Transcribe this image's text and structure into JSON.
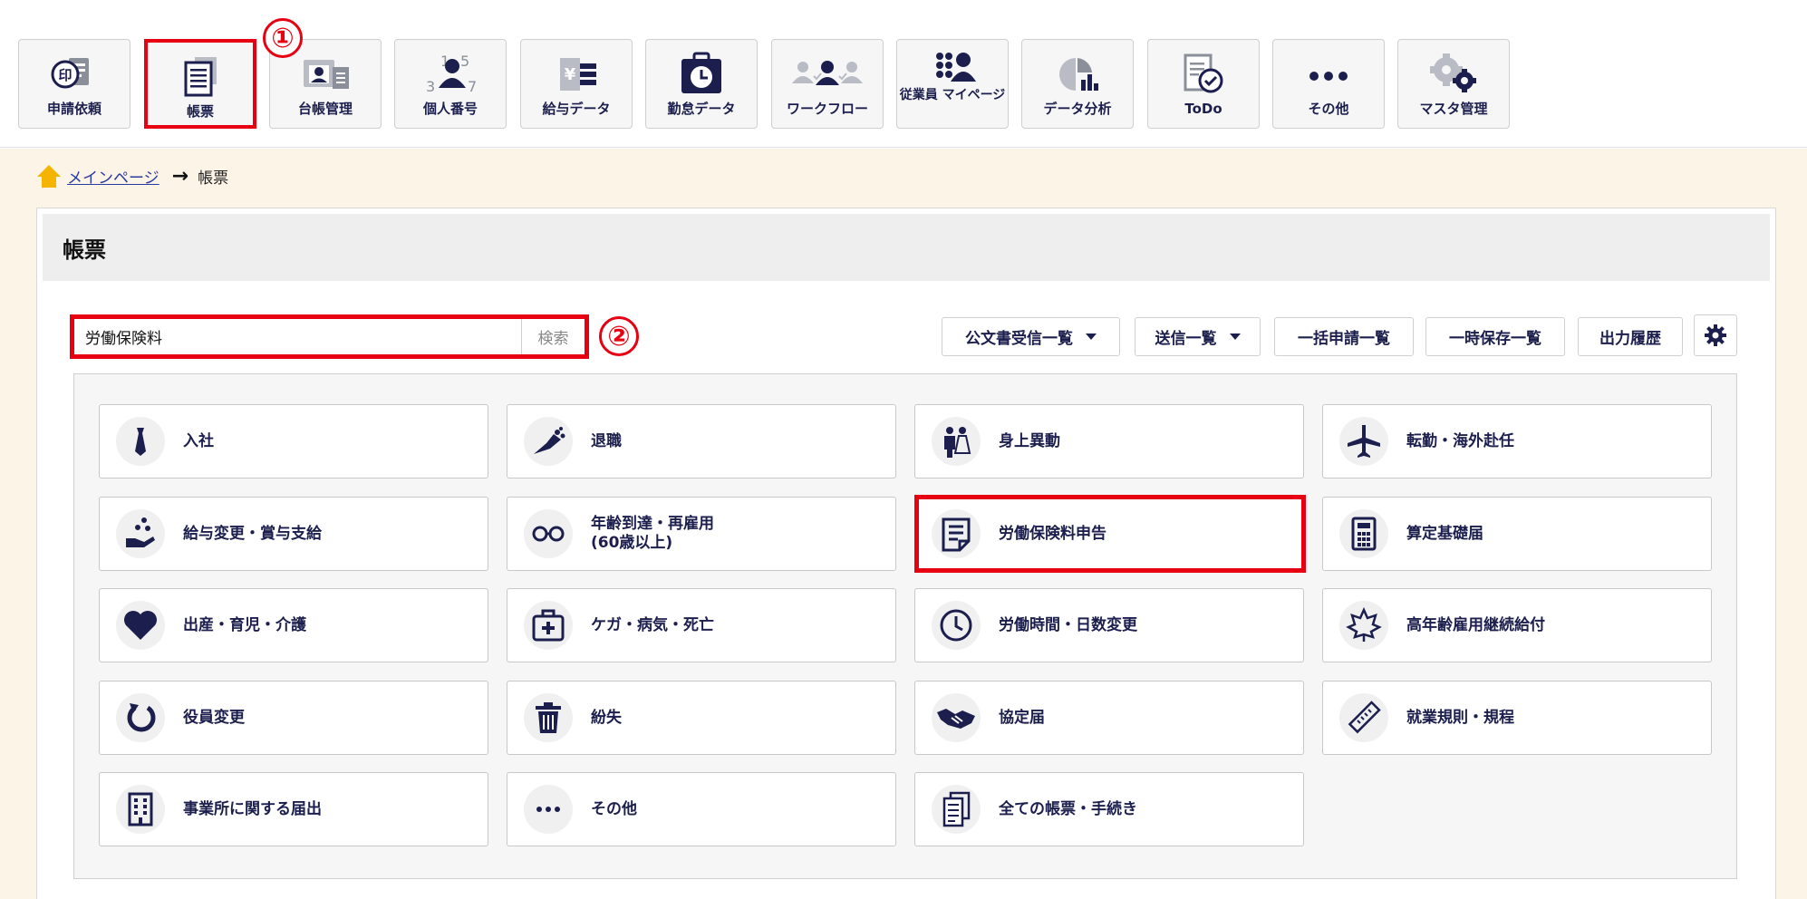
{
  "topnav": {
    "items": [
      {
        "label": "申請依頼",
        "icon": "stamp-request-icon"
      },
      {
        "label": "帳票",
        "icon": "document-forms-icon",
        "selected": true
      },
      {
        "label": "台帳管理",
        "icon": "ledger-card-icon"
      },
      {
        "label": "個人番号",
        "icon": "personal-number-icon"
      },
      {
        "label": "給与データ",
        "icon": "payroll-data-icon"
      },
      {
        "label": "勤怠データ",
        "icon": "attendance-clock-icon"
      },
      {
        "label": "ワークフロー",
        "icon": "workflow-people-icon"
      },
      {
        "label": "従業員\nマイページ",
        "icon": "employee-mypage-icon"
      },
      {
        "label": "データ分析",
        "icon": "data-analysis-icon"
      },
      {
        "label": "ToDo",
        "icon": "todo-check-icon"
      },
      {
        "label": "その他",
        "icon": "more-dots-icon"
      },
      {
        "label": "マスタ管理",
        "icon": "master-gears-icon"
      }
    ]
  },
  "callouts": {
    "one": "①",
    "two": "②"
  },
  "breadcrumb": {
    "home": "メインページ",
    "arrow": "→",
    "current": "帳票"
  },
  "panel": {
    "title": "帳票"
  },
  "search": {
    "value": "労働保険料",
    "button": "検索"
  },
  "toolbar": {
    "official_received": "公文書受信一覧",
    "sent_list": "送信一覧",
    "bulk_applications": "一括申請一覧",
    "temp_saved": "一時保存一覧",
    "output_history": "出力履歴",
    "settings_icon": "gear-icon"
  },
  "tiles": [
    {
      "label": "入社",
      "icon": "tie-icon"
    },
    {
      "label": "退職",
      "icon": "bouquet-icon"
    },
    {
      "label": "身上異動",
      "icon": "wedding-couple-icon"
    },
    {
      "label": "転勤・海外赴任",
      "icon": "airplane-icon"
    },
    {
      "label": "給与変更・賞与支給",
      "icon": "hand-coins-icon"
    },
    {
      "label": "年齢到達・再雇用\n(60歳以上)",
      "icon": "glasses-icon"
    },
    {
      "label": "労働保険料申告",
      "icon": "document-lines-icon",
      "highlighted": true
    },
    {
      "label": "算定基礎届",
      "icon": "calculator-icon"
    },
    {
      "label": "出産・育児・介護",
      "icon": "heart-icon"
    },
    {
      "label": "ケガ・病気・死亡",
      "icon": "first-aid-kit-icon"
    },
    {
      "label": "労働時間・日数変更",
      "icon": "clock-icon"
    },
    {
      "label": "高年齢雇用継続給付",
      "icon": "maple-leaf-icon"
    },
    {
      "label": "役員変更",
      "icon": "refresh-arrow-icon"
    },
    {
      "label": "紛失",
      "icon": "trash-can-icon"
    },
    {
      "label": "協定届",
      "icon": "handshake-icon"
    },
    {
      "label": "就業規則・規程",
      "icon": "ruler-icon"
    },
    {
      "label": "事業所に関する届出",
      "icon": "office-building-icon"
    },
    {
      "label": "その他",
      "icon": "more-dots-icon"
    },
    {
      "label": "全ての帳票・手続き",
      "icon": "document-copy-icon"
    }
  ],
  "colors": {
    "navy": "#1c1f4d",
    "highlight": "#e60012",
    "peach": "#fdf4e8",
    "link": "#2b3aa0",
    "home_icon": "#f5b400"
  }
}
